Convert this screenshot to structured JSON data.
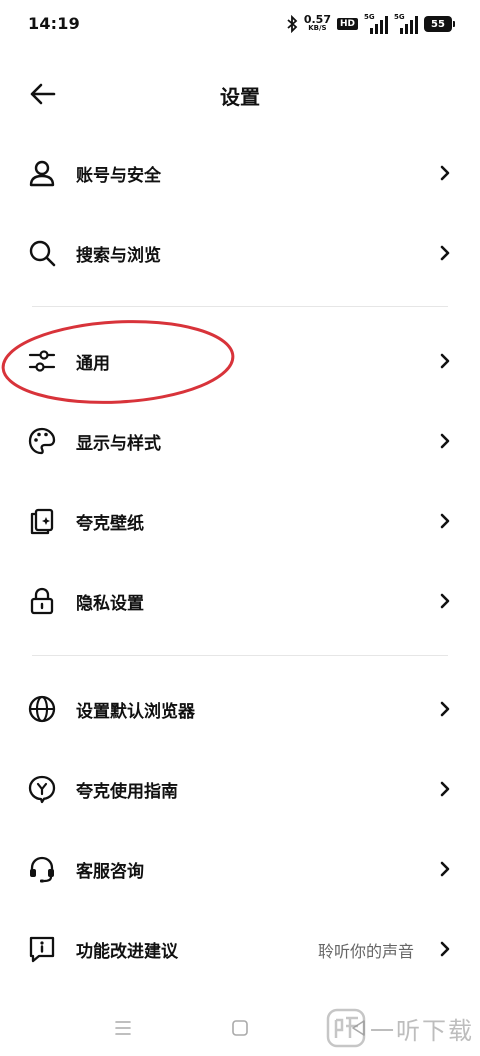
{
  "status_bar": {
    "time": "14:19",
    "speed_value": "0.57",
    "speed_unit": "KB/S",
    "hd_label": "HD",
    "signal_1_label": "5G",
    "signal_2_label": "5G",
    "battery": "55"
  },
  "header": {
    "title": "设置",
    "back_icon": "arrow-left-icon"
  },
  "settings": {
    "items": [
      {
        "label": "账号与安全",
        "icon": "person-icon"
      },
      {
        "label": "搜索与浏览",
        "icon": "search-icon"
      },
      {
        "label": "通用",
        "icon": "sliders-icon"
      },
      {
        "label": "显示与样式",
        "icon": "palette-icon"
      },
      {
        "label": "夸克壁纸",
        "icon": "wallpaper-icon"
      },
      {
        "label": "隐私设置",
        "icon": "lock-icon"
      },
      {
        "label": "设置默认浏览器",
        "icon": "globe-icon"
      },
      {
        "label": "夸克使用指南",
        "icon": "guide-icon"
      },
      {
        "label": "客服咨询",
        "icon": "headset-icon"
      },
      {
        "label": "功能改进建议",
        "icon": "feedback-icon",
        "value": "聆听你的声音"
      }
    ]
  },
  "annotation": {
    "highlight_color": "#d8333a",
    "highlighted_item": "通用"
  },
  "watermark": {
    "text": "一听下载"
  }
}
